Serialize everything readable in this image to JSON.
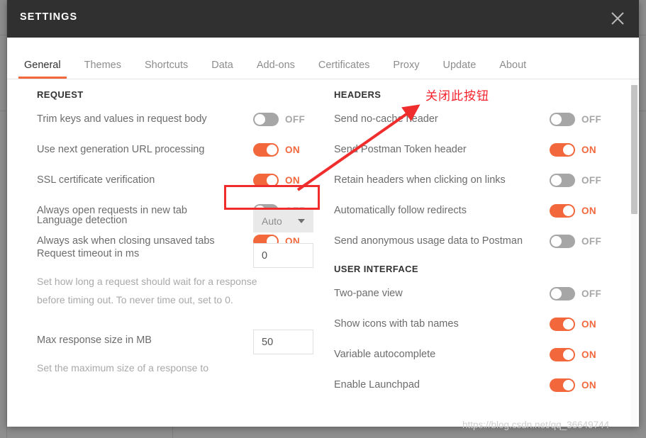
{
  "window": {
    "title": "SETTINGS",
    "close_icon": "close-icon"
  },
  "tabs": [
    {
      "label": "General",
      "active": true
    },
    {
      "label": "Themes",
      "active": false
    },
    {
      "label": "Shortcuts",
      "active": false
    },
    {
      "label": "Data",
      "active": false
    },
    {
      "label": "Add-ons",
      "active": false
    },
    {
      "label": "Certificates",
      "active": false
    },
    {
      "label": "Proxy",
      "active": false
    },
    {
      "label": "Update",
      "active": false
    },
    {
      "label": "About",
      "active": false
    }
  ],
  "left_column": {
    "section_title": "REQUEST",
    "rows": [
      {
        "label": "Trim keys and values in request body",
        "state": "OFF",
        "on": false
      },
      {
        "label": "Use next generation URL processing",
        "state": "ON",
        "on": true
      },
      {
        "label": "SSL certificate verification",
        "state": "ON",
        "on": true
      },
      {
        "label": "Always open requests in new tab",
        "state": "OFF",
        "on": false
      },
      {
        "label": "Always ask when closing unsaved tabs",
        "state": "ON",
        "on": true
      }
    ],
    "language_detection": {
      "label": "Language detection",
      "value": "Auto"
    },
    "request_timeout": {
      "label": "Request timeout in ms",
      "value": "0",
      "description": "Set how long a request should wait for a response before timing out. To never time out, set to 0."
    },
    "max_response_size": {
      "label": "Max response size in MB",
      "value": "50",
      "description": "Set the maximum size of a response to"
    }
  },
  "right_column": {
    "headers_section": {
      "title": "HEADERS",
      "rows": [
        {
          "label": "Send no-cache header",
          "state": "OFF",
          "on": false
        },
        {
          "label": "Send Postman Token header",
          "state": "ON",
          "on": true
        },
        {
          "label": "Retain headers when clicking on links",
          "state": "OFF",
          "on": false
        },
        {
          "label": "Automatically follow redirects",
          "state": "ON",
          "on": true
        },
        {
          "label": "Send anonymous usage data to Postman",
          "state": "OFF",
          "on": false
        }
      ]
    },
    "ui_section": {
      "title": "USER INTERFACE",
      "rows": [
        {
          "label": "Two-pane view",
          "state": "OFF",
          "on": false
        },
        {
          "label": "Show icons with tab names",
          "state": "ON",
          "on": true
        },
        {
          "label": "Variable autocomplete",
          "state": "ON",
          "on": true
        },
        {
          "label": "Enable Launchpad",
          "state": "ON",
          "on": true
        }
      ]
    }
  },
  "annotation": {
    "text": "关闭此按钮",
    "color": "#f5222d"
  },
  "watermark": {
    "text": "https://blog.csdn.net/qq_36649744"
  },
  "colors": {
    "accent": "#f2683c",
    "header_bg": "#303030",
    "toggle_off": "#a6a6a6",
    "annotation_red": "#ef2d2d"
  }
}
